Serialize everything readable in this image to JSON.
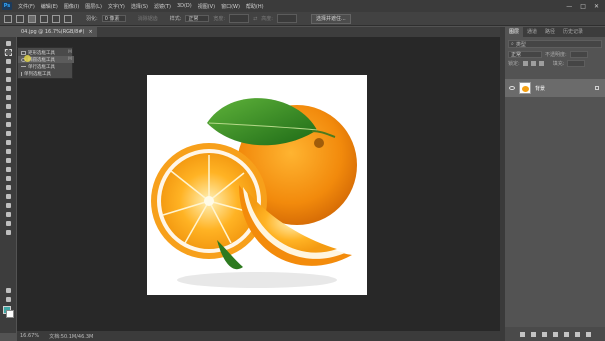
{
  "app": {
    "logo": "Ps",
    "menu": [
      "文件(F)",
      "编辑(E)",
      "图像(I)",
      "图层(L)",
      "文字(Y)",
      "选择(S)",
      "滤镜(T)",
      "3D(D)",
      "视图(V)",
      "窗口(W)",
      "帮助(H)"
    ],
    "window_controls": [
      "—",
      "□",
      "✕"
    ]
  },
  "options": {
    "feather_label": "羽化:",
    "feather_value": "0 像素",
    "antialias_label": "消除锯齿",
    "style_label": "样式:",
    "style_value": "正常",
    "width_label": "宽度:",
    "height_label": "高度:",
    "select_subject": "选择并遮住..."
  },
  "document": {
    "tab_title": "04.jpg @ 16.7%(RGB/8#)",
    "close": "×"
  },
  "flyout": {
    "items": [
      {
        "label": "矩形选框工具",
        "key": "M"
      },
      {
        "label": "椭圆选框工具",
        "key": "M"
      },
      {
        "label": "单行选框工具",
        "key": ""
      },
      {
        "label": "单列选框工具",
        "key": ""
      }
    ]
  },
  "status": {
    "zoom": "16.67%",
    "doc_size": "文档:50.1M/46.3M"
  },
  "layers_panel": {
    "tabs": [
      "图层",
      "通道",
      "路径",
      "历史记录"
    ],
    "search_placeholder": "类型",
    "blend_mode": "正常",
    "opacity_label": "不透明度:",
    "lock_label": "锁定:",
    "fill_label": "填充:",
    "layer_name": "背景"
  },
  "colors": {
    "foreground": "#3fa7a5",
    "background": "#ffffff",
    "accent": "#31a8ff"
  }
}
